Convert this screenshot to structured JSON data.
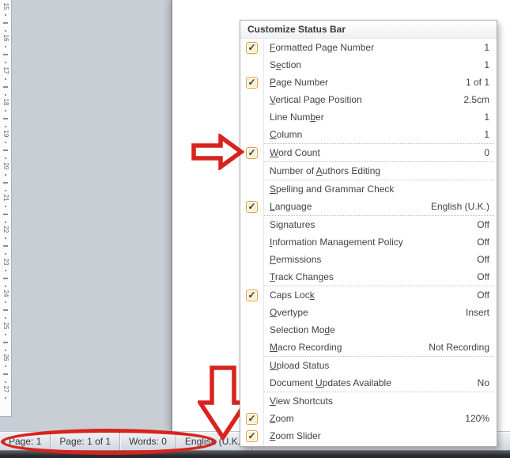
{
  "menu": {
    "title": "Customize Status Bar",
    "items": [
      {
        "label": "Formatted Page Number",
        "accel": 0,
        "checked": true,
        "value": "1"
      },
      {
        "label": "Section",
        "accel": 1,
        "checked": false,
        "value": "1"
      },
      {
        "label": "Page Number",
        "accel": 0,
        "checked": true,
        "value": "1 of 1"
      },
      {
        "label": "Vertical Page Position",
        "accel": 0,
        "checked": false,
        "value": "2.5cm"
      },
      {
        "label": "Line Number",
        "accel": 8,
        "checked": false,
        "value": "1"
      },
      {
        "label": "Column",
        "accel": 0,
        "checked": false,
        "value": "1",
        "sep_after": true
      },
      {
        "label": "Word Count",
        "accel": 0,
        "checked": true,
        "value": "0",
        "sep_after": true
      },
      {
        "label": "Number of Authors Editing",
        "accel": 10,
        "checked": false,
        "value": "",
        "sep_after": true
      },
      {
        "label": "Spelling and Grammar Check",
        "accel": 0,
        "checked": false,
        "value": ""
      },
      {
        "label": "Language",
        "accel": 0,
        "checked": true,
        "value": "English (U.K.)",
        "sep_after": true
      },
      {
        "label": "Signatures",
        "accel": 2,
        "checked": false,
        "value": "Off"
      },
      {
        "label": "Information Management Policy",
        "accel": 0,
        "checked": false,
        "value": "Off"
      },
      {
        "label": "Permissions",
        "accel": 0,
        "checked": false,
        "value": "Off"
      },
      {
        "label": "Track Changes",
        "accel": 0,
        "checked": false,
        "value": "Off",
        "sep_after": true
      },
      {
        "label": "Caps Lock",
        "accel": 8,
        "checked": true,
        "value": "Off"
      },
      {
        "label": "Overtype",
        "accel": 0,
        "checked": false,
        "value": "Insert"
      },
      {
        "label": "Selection Mode",
        "accel": 12,
        "checked": false,
        "value": ""
      },
      {
        "label": "Macro Recording",
        "accel": 0,
        "checked": false,
        "value": "Not Recording",
        "sep_after": true
      },
      {
        "label": "Upload Status",
        "accel": 0,
        "checked": false,
        "value": ""
      },
      {
        "label": "Document Updates Available",
        "accel": 9,
        "checked": false,
        "value": "No",
        "sep_after": true
      },
      {
        "label": "View Shortcuts",
        "accel": 0,
        "checked": false,
        "value": ""
      },
      {
        "label": "Zoom",
        "accel": 0,
        "checked": true,
        "value": "120%"
      },
      {
        "label": "Zoom Slider",
        "accel": 0,
        "checked": true,
        "value": ""
      }
    ]
  },
  "status_bar": {
    "segments": [
      {
        "label": "Page: 1"
      },
      {
        "label": "Page: 1 of 1"
      },
      {
        "label": "Words: 0"
      },
      {
        "label": "English (U.K.)"
      }
    ]
  },
  "ruler": {
    "numbers": [
      15,
      16,
      17,
      18,
      19,
      20,
      21,
      22,
      23,
      24,
      25,
      26,
      27
    ]
  },
  "icons": {
    "checkmark": "✓"
  },
  "colors": {
    "annotation_red": "#D8231E",
    "checkbox_fill": "#FCF1CB",
    "checkbox_border": "#DBA04A",
    "checkmark_navy": "#233A72"
  }
}
